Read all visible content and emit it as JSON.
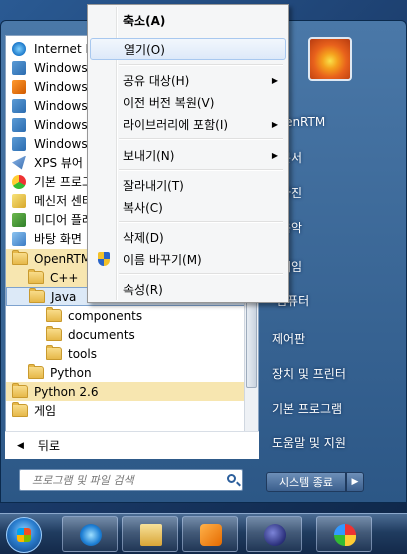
{
  "programs": {
    "items": [
      {
        "label": "Internet Ex",
        "icon": "internet-explorer-icon"
      },
      {
        "label": "Windows I",
        "icon": "windows-app-icon"
      },
      {
        "label": "Windows I",
        "icon": "windows-media-icon"
      },
      {
        "label": "Windows I",
        "icon": "windows-app-icon"
      },
      {
        "label": "Windows I",
        "icon": "windows-app-icon"
      },
      {
        "label": "Windows ",
        "icon": "windows-app-icon"
      },
      {
        "label": "XPS 뷰어",
        "icon": "xps-viewer-icon"
      },
      {
        "label": "기본 프로그",
        "icon": "default-programs-icon"
      },
      {
        "label": "메신저 센터",
        "icon": "messenger-icon"
      },
      {
        "label": "미디어 플레",
        "icon": "media-center-icon"
      },
      {
        "label": "바탕 화면",
        "icon": "desktop-gadget-icon"
      }
    ],
    "folders": {
      "openrtm": "OpenRTM-",
      "cpp": "C++",
      "java": "Java",
      "components": "components",
      "documents": "documents",
      "tools": "tools",
      "python": "Python",
      "python26": "Python 2.6",
      "game": "게임"
    },
    "back_label": "뒤로",
    "search_placeholder": "프로그램 및 파일 검색"
  },
  "right_pane": {
    "items": [
      "OpenRTM",
      "문서",
      "사진",
      "음악",
      "게임",
      "컴퓨터",
      "제어판",
      "장치 및 프린터",
      "기본 프로그램",
      "도움말 및 지원"
    ],
    "shutdown_label": "시스템 종료",
    "shutdown_arrow": "▶"
  },
  "context_menu": {
    "items": {
      "collapse": "축소(A)",
      "open": "열기(O)",
      "share": "공유 대상(H)",
      "restore": "이전 버전 복원(V)",
      "include_library": "라이브러리에 포함(I)",
      "send_to": "보내기(N)",
      "cut": "잘라내기(T)",
      "copy": "복사(C)",
      "delete": "삭제(D)",
      "rename": "이름 바꾸기(M)",
      "properties": "속성(R)"
    },
    "submenu_arrow": "▶"
  },
  "taskbar": {
    "apps": [
      "start-orb",
      "internet-explorer-icon",
      "file-explorer-icon",
      "windows-media-player-icon",
      "eclipse-icon",
      "paint-icon"
    ]
  }
}
